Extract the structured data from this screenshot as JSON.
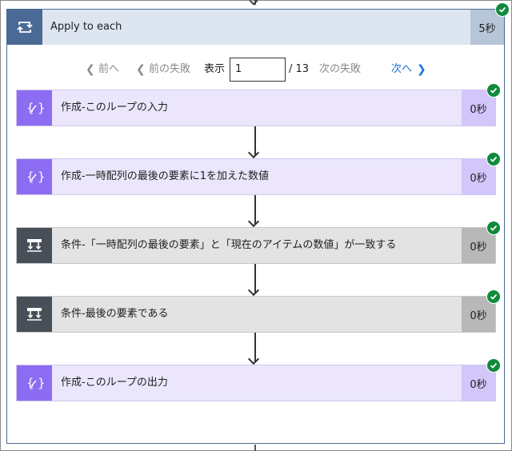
{
  "loop": {
    "title": "Apply to each",
    "duration": "5秒",
    "status": "succeeded"
  },
  "pager": {
    "prev_label": "前へ",
    "prev_failed_label": "前の失敗",
    "show_label": "表示",
    "page_value": "1",
    "total": "/ 13",
    "next_failed_label": "次の失敗",
    "next_label": "次へ"
  },
  "steps": [
    {
      "title": "作成-このループの入力",
      "duration": "0秒",
      "kind": "action",
      "icon": "compose-icon"
    },
    {
      "title": "作成-一時配列の最後の要素に1を加えた数値",
      "duration": "0秒",
      "kind": "action",
      "icon": "compose-icon"
    },
    {
      "title": "条件-「一時配列の最後の要素」と「現在のアイテムの数値」が一致する",
      "duration": "0秒",
      "kind": "condition",
      "icon": "condition-icon"
    },
    {
      "title": "条件-最後の要素である",
      "duration": "0秒",
      "kind": "condition",
      "icon": "condition-icon"
    },
    {
      "title": "作成-このループの出力",
      "duration": "0秒",
      "kind": "action",
      "icon": "compose-icon"
    }
  ],
  "colors": {
    "loop_accent": "#4a6a95",
    "action_accent": "#8c6cf2",
    "condition_accent": "#484f58",
    "success": "#0f8a3c",
    "link": "#1a6fd6"
  }
}
